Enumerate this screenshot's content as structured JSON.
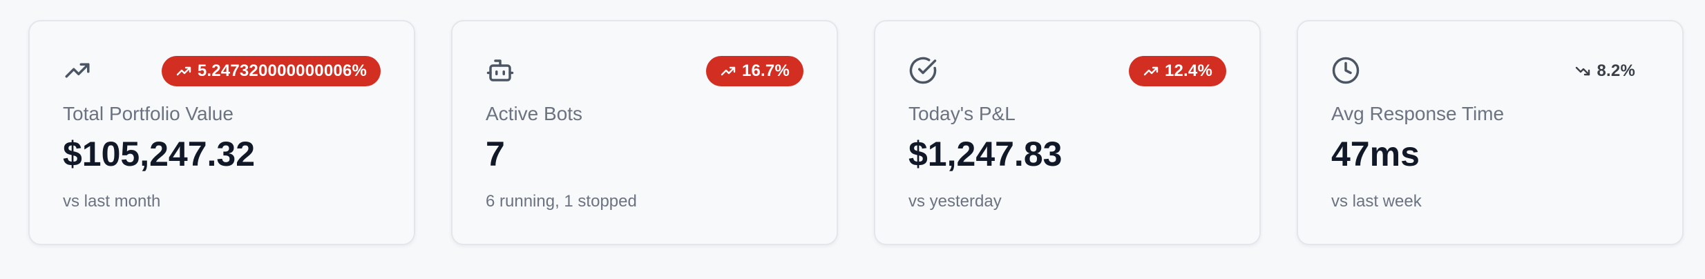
{
  "colors": {
    "badge_background": "#d22e22",
    "badge_text": "#ffffff",
    "neutral_badge_text": "#3a3f48",
    "label_text": "#6b7280",
    "value_text": "#111827",
    "icon_stroke": "#4b5563"
  },
  "cards": [
    {
      "icon": "trending-up-icon",
      "badge": {
        "icon": "trending-up-icon",
        "text": "5.247320000000006%",
        "style": "filled"
      },
      "label": "Total Portfolio Value",
      "value": "$105,247.32",
      "sub": "vs last month"
    },
    {
      "icon": "bot-icon",
      "badge": {
        "icon": "trending-up-icon",
        "text": "16.7%",
        "style": "filled"
      },
      "label": "Active Bots",
      "value": "7",
      "sub": "6 running, 1 stopped"
    },
    {
      "icon": "check-circle-icon",
      "badge": {
        "icon": "trending-up-icon",
        "text": "12.4%",
        "style": "filled"
      },
      "label": "Today's P&L",
      "value": "$1,247.83",
      "sub": "vs yesterday"
    },
    {
      "icon": "clock-icon",
      "badge": {
        "icon": "trending-down-icon",
        "text": "8.2%",
        "style": "plain"
      },
      "label": "Avg Response Time",
      "value": "47ms",
      "sub": "vs last week"
    }
  ]
}
